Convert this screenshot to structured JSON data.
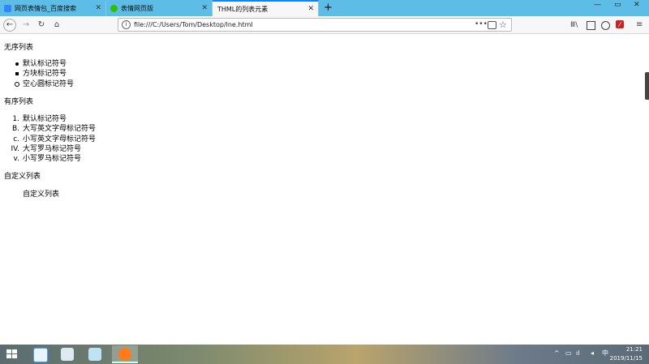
{
  "browser": {
    "tabs": [
      {
        "title": "网页表情包_百度搜索",
        "icon": "baidu-icon",
        "active": false
      },
      {
        "title": "表情网页版",
        "icon": "wechat-icon",
        "active": false
      },
      {
        "title": "THML的列表元素",
        "icon": "",
        "active": true
      }
    ],
    "new_tab": "+",
    "url": "file:///C:/Users/Tom/Desktop/lne.html",
    "page_actions": "•••"
  },
  "page": {
    "unordered_title": "无序列表",
    "unordered_items": [
      "默认标记符号",
      "方块标记符号",
      "空心圆标记符号"
    ],
    "ordered_title": "有序列表",
    "ordered_items": [
      {
        "marker": "1.",
        "text": "默认标记符号"
      },
      {
        "marker": "B.",
        "text": "大写英文字母标记符号"
      },
      {
        "marker": "c.",
        "text": "小写英文字母标记符号"
      },
      {
        "marker": "IV.",
        "text": "大写罗马标记符号"
      },
      {
        "marker": "v.",
        "text": "小写罗马标记符号"
      }
    ],
    "definition_title": "自定义列表",
    "definition_item": "自定义列表"
  },
  "taskbar": {
    "apps": [
      "start-icon",
      "baidu-netdisk-icon",
      "home-icon",
      "notepad-icon",
      "firefox-icon"
    ],
    "clock_time": "21:21",
    "clock_date": "2019/11/15"
  },
  "colors": {
    "tab_strip": "#5dbde6",
    "active_tab_accent": "#0a84ff"
  }
}
